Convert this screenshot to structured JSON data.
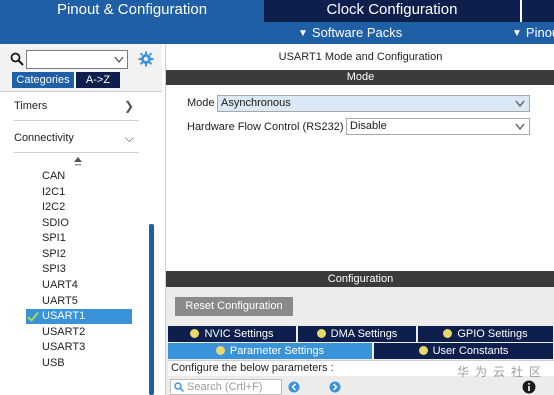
{
  "top_tabs": {
    "pinout": "Pinout & Configuration",
    "clock": "Clock Configuration"
  },
  "menu": {
    "software_packs": "Software Packs",
    "pinout": "Pinout"
  },
  "left": {
    "segments": {
      "categories": "Categories",
      "az": "A->Z"
    },
    "groups": [
      {
        "label": "Timers",
        "icon": "chevron-right-icon"
      },
      {
        "label": "Connectivity",
        "icon": "chevron-down-icon"
      }
    ],
    "peripherals": [
      "CAN",
      "I2C1",
      "I2C2",
      "SDIO",
      "SPI1",
      "SPI2",
      "SPI3",
      "UART4",
      "UART5",
      "USART1",
      "USART2",
      "USART3",
      "USB"
    ],
    "selected_peripheral": "USART1"
  },
  "main": {
    "title": "USART1 Mode and Configuration",
    "mode_header": "Mode",
    "mode_label": "Mode",
    "mode_value": "Asynchronous",
    "flow_label": "Hardware Flow Control (RS232)",
    "flow_value": "Disable",
    "config_header": "Configuration",
    "reset_button": "Reset Configuration",
    "tabs": [
      {
        "label": "NVIC Settings"
      },
      {
        "label": "DMA Settings"
      },
      {
        "label": "GPIO Settings"
      },
      {
        "label": "Parameter Settings"
      },
      {
        "label": "User Constants"
      }
    ],
    "description": "Configure the below parameters :",
    "search_placeholder": "Search (Crtl+F)",
    "watermark": "华为云社区"
  },
  "colors": {
    "dark_navy": "#0f1f4d",
    "accent_blue": "#1e5fa5",
    "selected_blue": "#3a92d8",
    "header_dark": "#3b3b3b",
    "dot_yellow": "#e8d86a"
  }
}
